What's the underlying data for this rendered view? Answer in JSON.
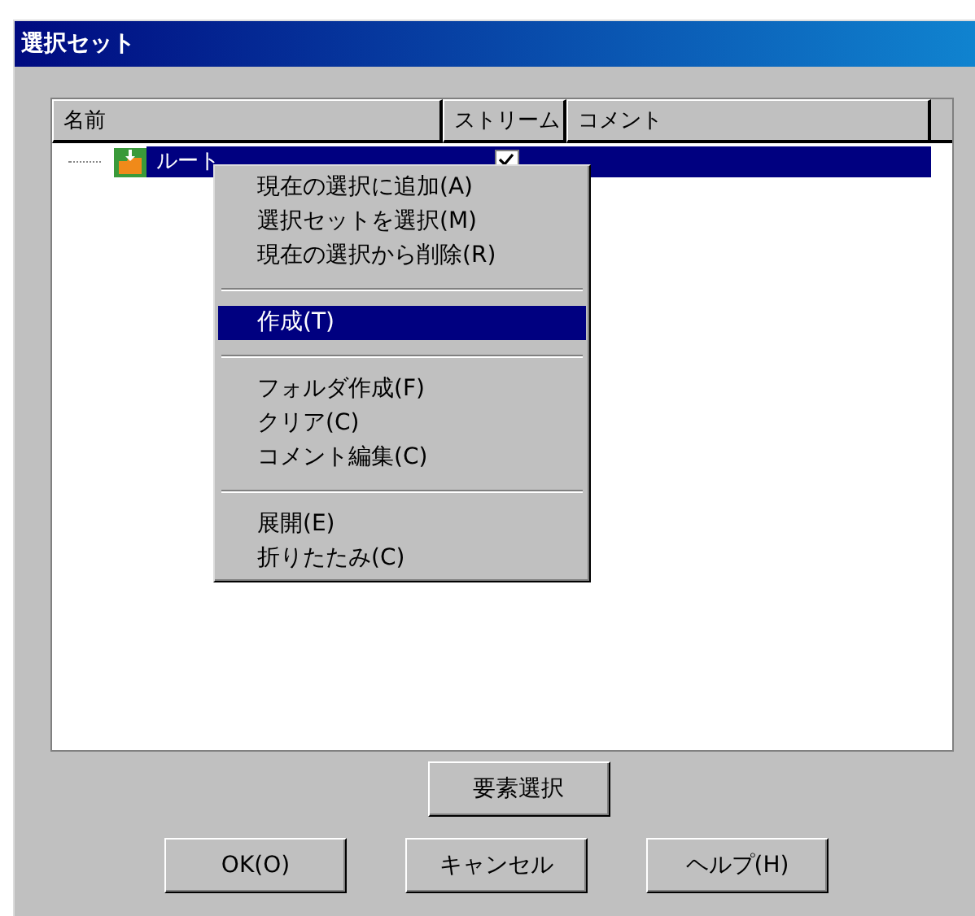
{
  "window": {
    "title": "選択セット"
  },
  "table": {
    "columns": [
      "名前",
      "ストリーム",
      "コメント"
    ],
    "rows": [
      {
        "name": "ルート",
        "checked": true,
        "selected": true
      }
    ]
  },
  "context_menu": [
    {
      "kind": "item",
      "label": "現在の選択に追加(A)",
      "selected": false
    },
    {
      "kind": "item",
      "label": "選択セットを選択(M)",
      "selected": false
    },
    {
      "kind": "item",
      "label": "現在の選択から削除(R)",
      "selected": false
    },
    {
      "kind": "separator"
    },
    {
      "kind": "item",
      "label": "作成(T)",
      "selected": true
    },
    {
      "kind": "separator"
    },
    {
      "kind": "item",
      "label": "フォルダ作成(F)",
      "selected": false
    },
    {
      "kind": "item",
      "label": "クリア(C)",
      "selected": false
    },
    {
      "kind": "item",
      "label": "コメント編集(C)",
      "selected": false
    },
    {
      "kind": "separator"
    },
    {
      "kind": "item",
      "label": "展開(E)",
      "selected": false
    },
    {
      "kind": "item",
      "label": "折りたたみ(C)",
      "selected": false
    }
  ],
  "buttons": {
    "select": "要素選択",
    "row": [
      "OK(O)",
      "キャンセル",
      "ヘルプ(H)"
    ]
  }
}
